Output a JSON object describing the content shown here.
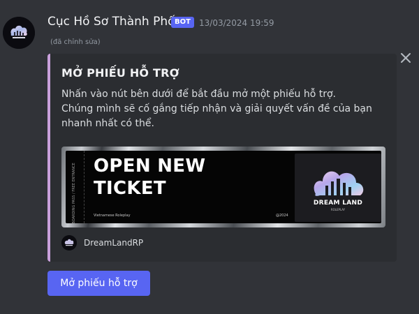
{
  "message": {
    "author": "Cục Hồ Sơ Thành Phố",
    "bot_tag": "BOT",
    "timestamp": "13/03/2024 19:59",
    "edited_label": "(đã chỉnh sửa)"
  },
  "embed": {
    "accent_color": "#c9a0dc",
    "title": "MỞ PHIẾU HỖ TRỢ",
    "description_lines": [
      "Nhấn vào nút bên dưới để bắt đầu mở một phiếu hỗ trợ.",
      "Chúng mình sẽ cố gắng tiếp nhận và giải quyết vấn đề của bạn",
      "nhanh nhất có thể."
    ],
    "image": {
      "heading_line1": "OPEN NEW",
      "heading_line2": "TICKET",
      "stub_text": "BOARDING PASS / FREE ENTRANCE",
      "footer_left": "Vietnamese Roleplay",
      "footer_right": "@2024",
      "logo_text": "DREAM LAND",
      "logo_subtext": "ROLEPLAY"
    },
    "footer": {
      "text": "DreamLandRP"
    },
    "close_icon": "close-icon"
  },
  "button": {
    "label": "Mở phiếu hỗ trợ",
    "color": "#5865f2"
  }
}
